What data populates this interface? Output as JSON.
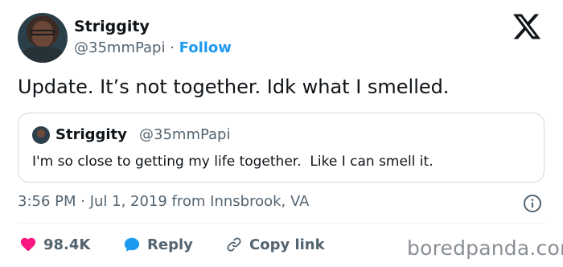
{
  "tweet": {
    "display_name": "Striggity",
    "handle": "@35mmPapi",
    "separator": " · ",
    "follow_label": "Follow",
    "text": "Update. It’s not together. Idk what I smelled.",
    "quoted": {
      "display_name": "Striggity",
      "handle": "@35mmPapi",
      "text": "I'm so close to getting my life together.  Like I can smell it."
    },
    "timestamp": "3:56 PM · Jul 1, 2019 from Innsbrook, VA",
    "actions": {
      "likes": "98.4K",
      "reply_label": "Reply",
      "copy_link_label": "Copy link"
    }
  },
  "icons": {
    "brand": "x-logo-icon",
    "info": "info-icon",
    "like": "heart-icon",
    "reply": "speech-bubble-icon",
    "copy": "link-icon"
  },
  "colors": {
    "follow": "#1d9bf0",
    "heart": "#f91880",
    "reply_bubble": "#1d9bf0",
    "muted": "#536471"
  },
  "watermark": "boredpanda.com"
}
